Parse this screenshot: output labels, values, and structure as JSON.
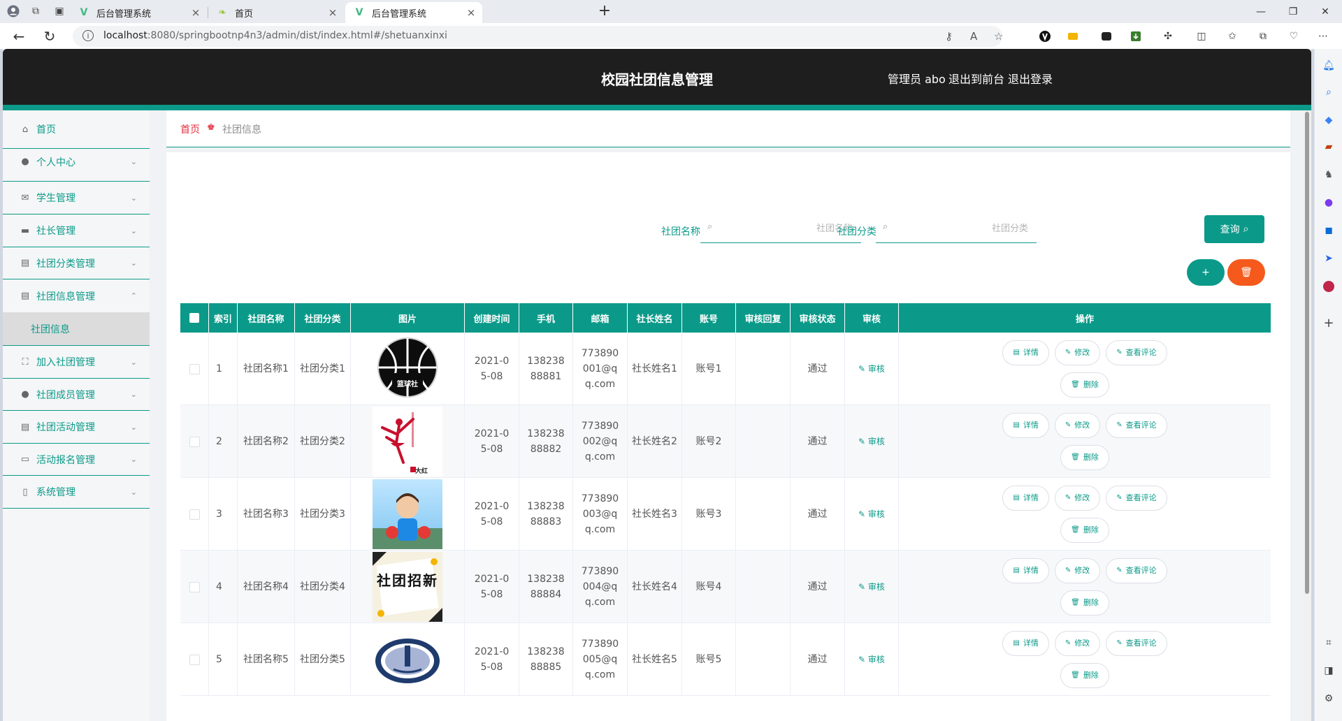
{
  "browser": {
    "tabs": [
      {
        "title": "后台管理系统",
        "active": false,
        "favicon": "vue-logo-icon"
      },
      {
        "title": "首页",
        "active": false,
        "favicon": "leaf-icon"
      },
      {
        "title": "后台管理系统",
        "active": true,
        "favicon": "vue-logo-icon"
      }
    ],
    "url_host": "localhost",
    "url_rest": ":8080/springbootnp4n3/admin/dist/index.html#/shetuanxinxi"
  },
  "app": {
    "title": "校园社团信息管理",
    "admin_label": "管理员 abo",
    "to_front_label": "退出到前台",
    "logout_label": "退出登录",
    "accent_color": "#0b9a89"
  },
  "sidebar": {
    "items": [
      {
        "label": "首页",
        "icon": "home-icon",
        "has_arrow": false
      },
      {
        "label": "个人中心",
        "icon": "user-icon",
        "has_arrow": true
      },
      {
        "label": "学生管理",
        "icon": "mail-icon",
        "has_arrow": true
      },
      {
        "label": "社长管理",
        "icon": "id-card-icon",
        "has_arrow": true
      },
      {
        "label": "社团分类管理",
        "icon": "clipboard-icon",
        "has_arrow": true
      },
      {
        "label": "社团信息管理",
        "icon": "clipboard-icon",
        "has_arrow": true,
        "expanded": true
      },
      {
        "label": "加入社团管理",
        "icon": "expand-icon",
        "has_arrow": true
      },
      {
        "label": "社团成员管理",
        "icon": "user-icon",
        "has_arrow": true
      },
      {
        "label": "社团活动管理",
        "icon": "clipboard-icon",
        "has_arrow": true
      },
      {
        "label": "活动报名管理",
        "icon": "card-icon",
        "has_arrow": true
      },
      {
        "label": "系统管理",
        "icon": "phone-icon",
        "has_arrow": true
      }
    ],
    "active_sub": "社团信息"
  },
  "breadcrumb": {
    "home": "首页",
    "current": "社团信息"
  },
  "search": {
    "name_label": "社团名称",
    "name_placeholder": "社团名称",
    "category_label": "社团分类",
    "category_placeholder": "社团分类",
    "query_label": "查询",
    "add_label": "+"
  },
  "table": {
    "columns": [
      "",
      "索引",
      "社团名称",
      "社团分类",
      "图片",
      "创建时间",
      "手机",
      "邮箱",
      "社长姓名",
      "账号",
      "审核回复",
      "审核状态",
      "审核",
      "操作"
    ],
    "rows": [
      {
        "index": "1",
        "name": "社团名称1",
        "category": "社团分类1",
        "image": "basketball",
        "image_text": "篮球社",
        "created": "2021-05-08",
        "phone": "13823888881",
        "email": "773890001@qq.com",
        "leader": "社长姓名1",
        "account": "账号1",
        "reply": "",
        "status": "通过"
      },
      {
        "index": "2",
        "name": "社团名称2",
        "category": "社团分类2",
        "image": "dance",
        "image_text": "大红",
        "created": "2021-05-08",
        "phone": "13823888882",
        "email": "773890002@qq.com",
        "leader": "社长姓名2",
        "account": "账号2",
        "reply": "",
        "status": "通过"
      },
      {
        "index": "3",
        "name": "社团名称3",
        "category": "社团分类3",
        "image": "photo",
        "image_text": "",
        "created": "2021-05-08",
        "phone": "13823888883",
        "email": "773890003@qq.com",
        "leader": "社长姓名3",
        "account": "账号3",
        "reply": "",
        "status": "通过"
      },
      {
        "index": "4",
        "name": "社团名称4",
        "category": "社团分类4",
        "image": "poster",
        "image_text": "社团招新",
        "created": "2021-05-08",
        "phone": "13823888884",
        "email": "773890004@qq.com",
        "leader": "社长姓名4",
        "account": "账号4",
        "reply": "",
        "status": "通过"
      },
      {
        "index": "5",
        "name": "社团名称5",
        "category": "社团分类5",
        "image": "emblem",
        "image_text": "",
        "created": "2021-05-08",
        "phone": "13823888885",
        "email": "773890005@qq.com",
        "leader": "社长姓名5",
        "account": "账号5",
        "reply": "",
        "status": "通过"
      }
    ],
    "audit_label": "审核",
    "op_labels": {
      "detail": "详情",
      "edit": "修改",
      "comments": "查看评论",
      "delete": "删除"
    }
  }
}
